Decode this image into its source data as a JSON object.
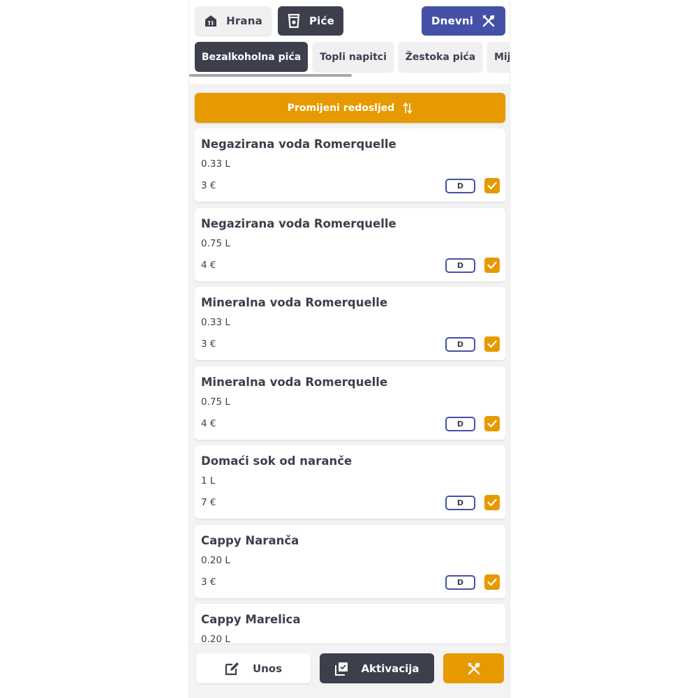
{
  "header": {
    "food_label": "Hrana",
    "drinks_label": "Piće",
    "daily_label": "Dnevni"
  },
  "tabs": [
    {
      "label": "Bezalkoholna pića",
      "active": true
    },
    {
      "label": "Topli napitci",
      "active": false
    },
    {
      "label": "Žestoka pića",
      "active": false
    },
    {
      "label": "Mij",
      "active": false
    }
  ],
  "reorder_label": "Promijeni redosljed",
  "items": [
    {
      "name": "Negazirana voda Romerquelle",
      "volume": "0.33 L",
      "price": "3 €",
      "badge": "D",
      "checked": true
    },
    {
      "name": "Negazirana voda Romerquelle",
      "volume": "0.75 L",
      "price": "4 €",
      "badge": "D",
      "checked": true
    },
    {
      "name": "Mineralna voda Romerquelle",
      "volume": "0.33 L",
      "price": "3 €",
      "badge": "D",
      "checked": true
    },
    {
      "name": "Mineralna voda Romerquelle",
      "volume": "0.75 L",
      "price": "4 €",
      "badge": "D",
      "checked": true
    },
    {
      "name": "Domaći sok od naranče",
      "volume": "1 L",
      "price": "7 €",
      "badge": "D",
      "checked": true
    },
    {
      "name": "Cappy Naranča",
      "volume": "0.20 L",
      "price": "3 €",
      "badge": "D",
      "checked": true
    },
    {
      "name": "Cappy Marelica",
      "volume": "0.20 L",
      "price": "",
      "badge": "",
      "checked": false
    }
  ],
  "bottom": {
    "entry_label": "Unos",
    "activation_label": "Aktivacija"
  },
  "colors": {
    "accent": "#e69a00",
    "primary_dark": "#3d3f4d",
    "daily_blue": "#4551a6"
  },
  "icons": {
    "food": "house-cutlery-icon",
    "drinks": "cup-icon",
    "daily": "fork-knife-cross-icon",
    "reorder": "sort-arrows-icon",
    "entry": "edit-icon",
    "activation": "copy-check-icon",
    "check": "checkmark-icon"
  }
}
